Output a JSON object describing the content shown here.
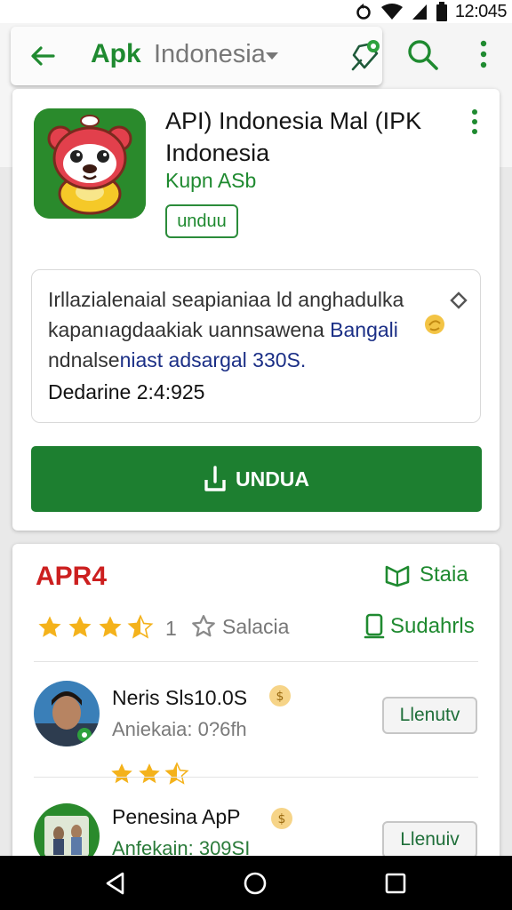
{
  "status_bar": {
    "time": "12:045"
  },
  "header": {
    "brand": "Apk",
    "search_text": "Indonesia"
  },
  "app": {
    "title": "API) Indonesia Mal (IPK Indonesia",
    "developer": "Kupn ASb",
    "chip_label": "unduu",
    "description": {
      "line1": "Irllazialenaial seapianiaa ld anghadulka",
      "line2_plain": "kapanıagdaakiak uannsawena",
      "line2_highlight": "Bangali",
      "line3_plain": "ndnalse",
      "line3_highlight": "niast adsargal 330S."
    },
    "date_line": "Dedarine 2:4:925",
    "install_label": "UNDUA"
  },
  "ratings": {
    "heading": "APR4",
    "stats_label": "Staia",
    "stars_value": 3.5,
    "count": "1",
    "salacia_label": "Salacia",
    "sudah_label": "Sudahrls"
  },
  "reviews": [
    {
      "name": "Neris Sls10.0S",
      "sub": "Aniekaia: 0?6fh",
      "button": "Llenutv",
      "stars_value": 2.5
    },
    {
      "name": "Penesina ApP",
      "sub": "Anfekain: 309SI",
      "button": "Llenuiv"
    }
  ],
  "colors": {
    "brand_green": "#1f8a30",
    "button_green": "#1d7f30",
    "rating_red": "#cc1f1f",
    "star_gold": "#f4b21b"
  }
}
